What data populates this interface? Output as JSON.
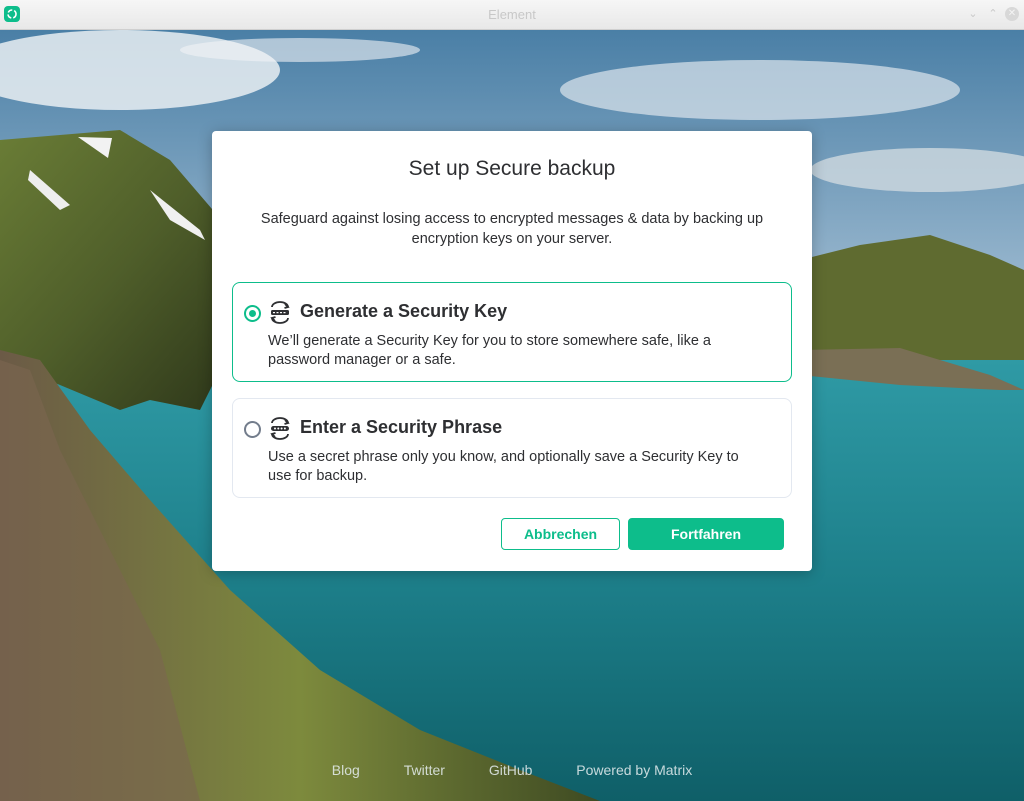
{
  "window": {
    "title": "Element"
  },
  "dialog": {
    "title": "Set up Secure backup",
    "description": "Safeguard against losing access to encrypted messages & data by backing up encryption keys on your server.",
    "options": [
      {
        "title": "Generate a Security Key",
        "description": "We’ll generate a Security Key for you to store somewhere safe, like a password manager or a safe.",
        "selected": true,
        "icon": "security-key-icon"
      },
      {
        "title": "Enter a Security Phrase",
        "description": "Use a secret phrase only you know, and optionally save a Security Key to use for backup.",
        "selected": false,
        "icon": "security-phrase-icon"
      }
    ],
    "cancel_label": "Abbrechen",
    "continue_label": "Fortfahren"
  },
  "footer": {
    "links": [
      "Blog",
      "Twitter",
      "GitHub",
      "Powered by Matrix"
    ]
  },
  "colors": {
    "accent": "#0dbd8b",
    "text": "#2e2f32"
  }
}
